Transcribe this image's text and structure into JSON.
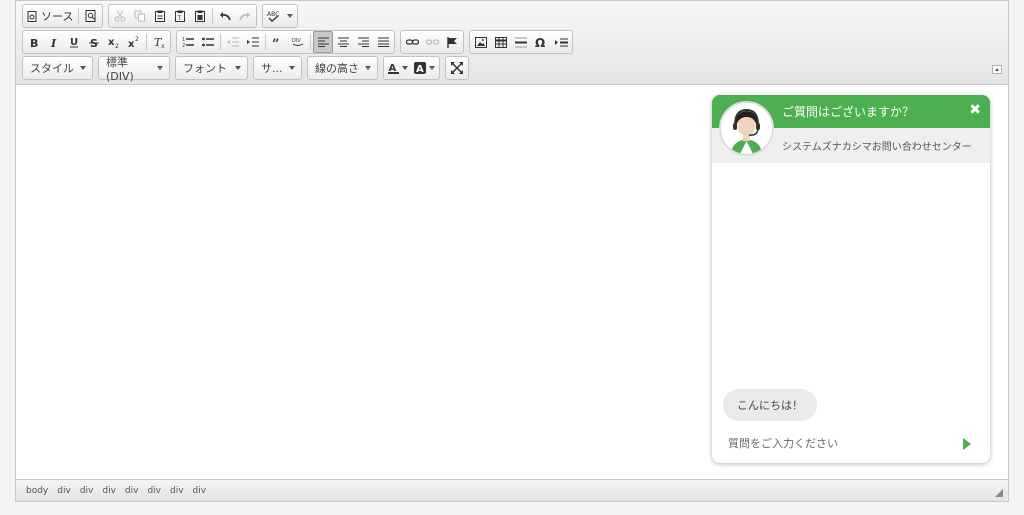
{
  "toolbar": {
    "source_label": "ソース",
    "styles_combo": "スタイル",
    "format_combo": "標準 (DIV)",
    "font_combo": "フォント",
    "size_combo": "サ...",
    "line_height_combo": "線の高さ"
  },
  "icons": {
    "row1": [
      "source-icon",
      "preview-icon",
      "cut-icon",
      "copy-icon",
      "paste-icon",
      "paste-text-icon",
      "paste-word-icon",
      "undo-icon",
      "redo-icon",
      "spellcheck-icon"
    ],
    "row2": [
      "bold-icon",
      "italic-icon",
      "underline-icon",
      "strike-icon",
      "subscript-icon",
      "superscript-icon",
      "remove-format-icon",
      "numbered-list-icon",
      "bulleted-list-icon",
      "outdent-icon",
      "indent-icon",
      "blockquote-icon",
      "div-icon",
      "align-left-icon",
      "align-center-icon",
      "align-right-icon",
      "justify-icon",
      "link-icon",
      "unlink-icon",
      "anchor-icon",
      "image-icon",
      "table-icon",
      "horizontal-rule-icon",
      "special-char-icon",
      "page-break-icon"
    ]
  },
  "statusbar": {
    "path": [
      "body",
      "div",
      "div",
      "div",
      "div",
      "div",
      "div",
      "div"
    ]
  },
  "chat": {
    "title": "ご質問はございますか？",
    "close": "✖",
    "subtitle": "システムズナカシマお問い合わせセンター",
    "greeting": "こんにちは！",
    "input_placeholder": "質問をご入力ください",
    "accent": "#4caf50"
  }
}
